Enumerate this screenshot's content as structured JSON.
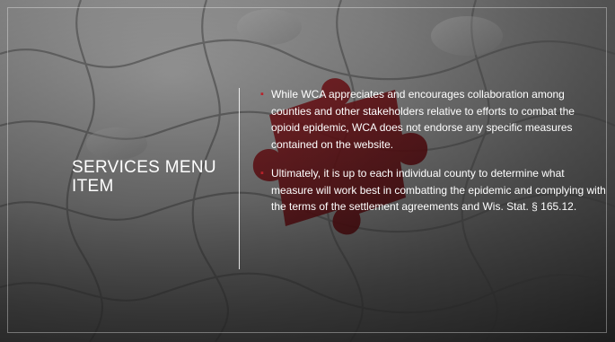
{
  "slide": {
    "title": "SERVICES MENU ITEM",
    "bullets": [
      {
        "mark": "▪",
        "text": "While WCA appreciates and encourages collaboration among counties and other stakeholders relative to efforts to combat the opioid epidemic, WCA does not endorse any specific measures contained on the website."
      },
      {
        "mark": "▪",
        "text": "Ultimately, it is up to each individual county to determine what measure will work best in combatting the epidemic and complying with the terms of the settlement agreements and Wis. Stat. § 165.12."
      }
    ]
  },
  "colors": {
    "accent_piece": "#8b1a1f",
    "bullet": "#b8232b",
    "text": "#ffffff"
  }
}
